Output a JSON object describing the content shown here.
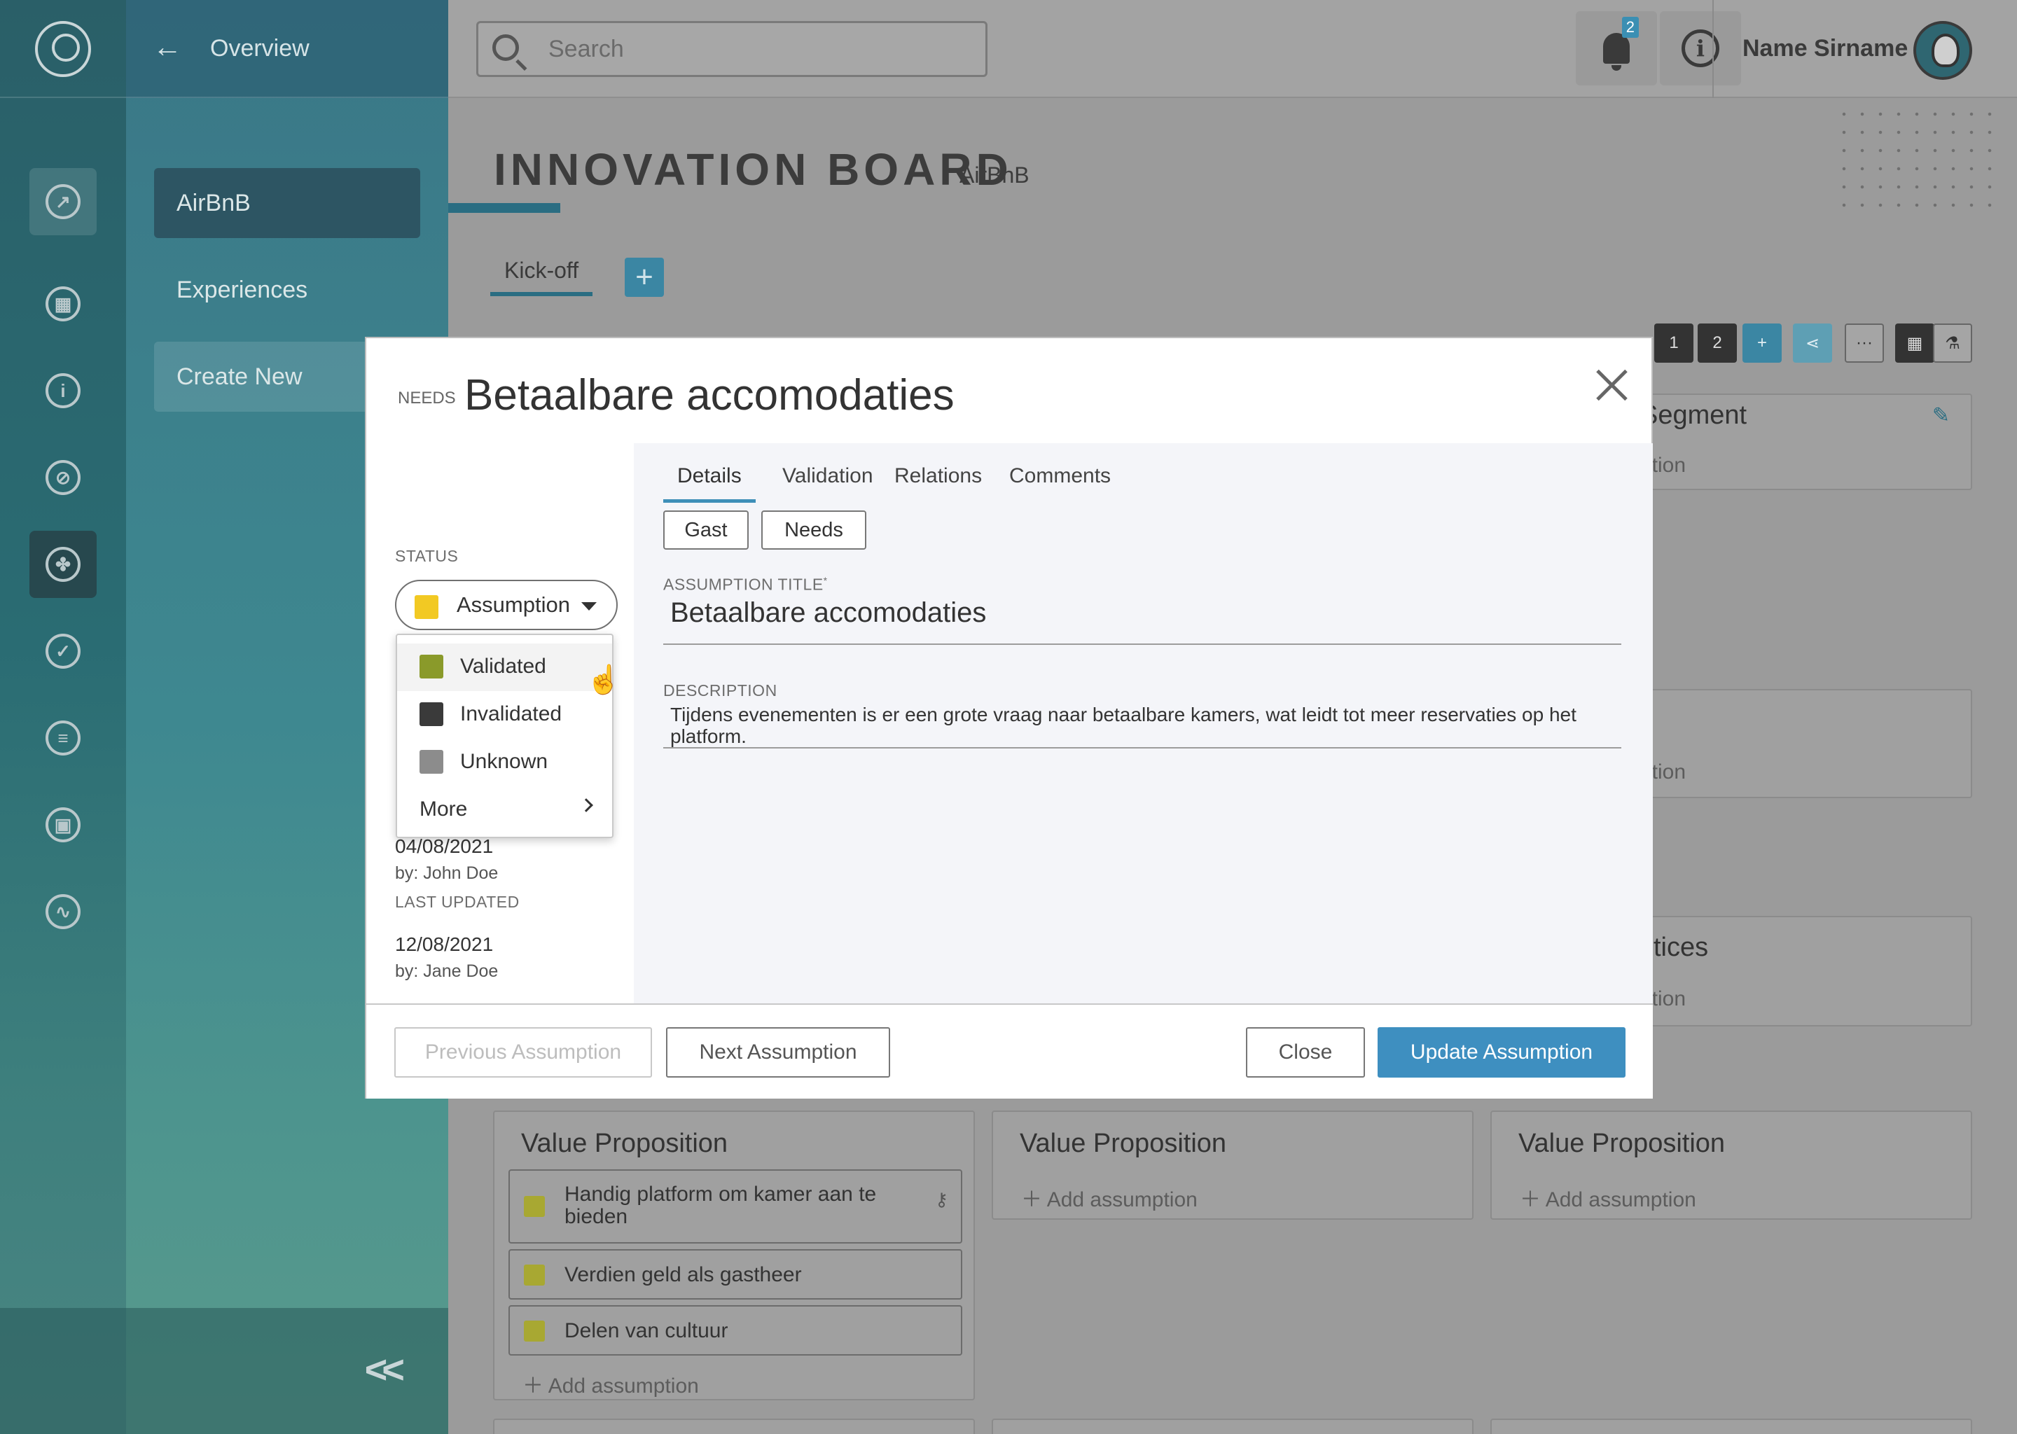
{
  "header": {
    "search_placeholder": "Search",
    "notifications_count": "2",
    "user_name": "Name Sirname"
  },
  "sidebar": {
    "back_label": "Overview",
    "items": [
      {
        "label": "AirBnB"
      },
      {
        "label": "Experiences"
      },
      {
        "label": "Create New"
      }
    ]
  },
  "board": {
    "title": "INNOVATION BOARD",
    "subtitle": "AirBnB",
    "tab": "Kick-off",
    "toolbar": {
      "page1": "1",
      "page2": "2"
    },
    "cards": {
      "segment_title": "Segment",
      "assumption_partial": "ption",
      "practices_title": "ctices",
      "vp_title": "Value Proposition",
      "add_assumption": "Add assumption",
      "items": [
        "Handig platform om kamer aan te bieden",
        "Verdien geld als gastheer",
        "Delen van cultuur"
      ]
    }
  },
  "modal": {
    "category": "NEEDS",
    "title": "Betaalbare accomodaties",
    "status_label": "STATUS",
    "status_value": "Assumption",
    "status_options": [
      {
        "label": "Validated",
        "color": "#8a9a2a"
      },
      {
        "label": "Invalidated",
        "color": "#3a3a3a"
      },
      {
        "label": "Unknown",
        "color": "#8c8c8c"
      },
      {
        "label": "More"
      }
    ],
    "created_date": "04/08/2021",
    "created_by": "by: John Doe",
    "last_updated_label": "LAST UPDATED",
    "updated_date": "12/08/2021",
    "updated_by": "by: Jane Doe",
    "tabs": [
      "Details",
      "Validation",
      "Relations",
      "Comments"
    ],
    "tags": [
      "Gast",
      "Needs"
    ],
    "assumption_title_label": "ASSUMPTION TITLE",
    "assumption_title_value": "Betaalbare accomodaties",
    "description_label": "DESCRIPTION",
    "description_value": "Tijdens evenementen is er een grote vraag naar betaalbare kamers, wat leidt tot meer reservaties op het platform.",
    "buttons": {
      "previous": "Previous Assumption",
      "next": "Next Assumption",
      "close": "Close",
      "update": "Update Assumption"
    }
  },
  "colors": {
    "accent": "#3e8fc0",
    "status_assumption": "#f2c923"
  }
}
